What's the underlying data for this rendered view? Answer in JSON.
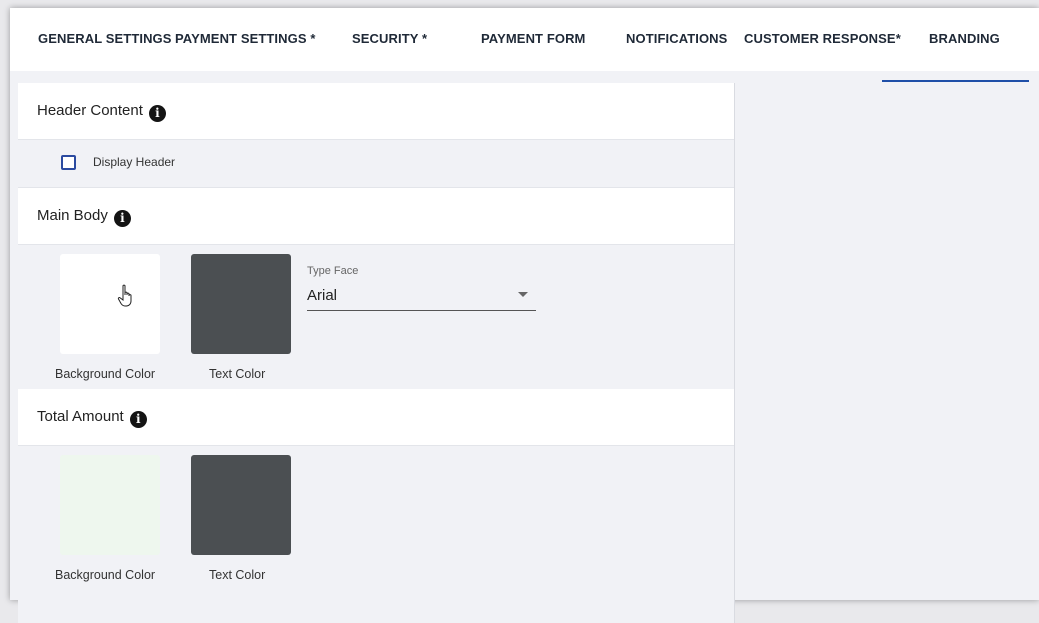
{
  "tabs": [
    {
      "label": "GENERAL SETTINGS"
    },
    {
      "label": "PAYMENT SETTINGS *"
    },
    {
      "label": "SECURITY *"
    },
    {
      "label": "PAYMENT FORM"
    },
    {
      "label": "NOTIFICATIONS"
    },
    {
      "label": "CUSTOMER RESPONSE*"
    },
    {
      "label": "BRANDING",
      "active": true
    }
  ],
  "sections": {
    "header_content": {
      "title": "Header Content",
      "display_header_label": "Display Header",
      "display_header_checked": false
    },
    "main_body": {
      "title": "Main Body",
      "background_label": "Background Color",
      "background_color": "#ffffff",
      "text_label": "Text Color",
      "text_color": "#4b4f52",
      "typeface_label": "Type Face",
      "typeface_value": "Arial"
    },
    "total_amount": {
      "title": "Total Amount",
      "background_label": "Background Color",
      "background_color": "#eef7ee",
      "text_label": "Text Color",
      "text_color": "#4b4f52"
    }
  },
  "icons": {
    "info": "info-icon",
    "cursor": "hand-pointer-icon",
    "dropdown": "caret-down-icon"
  },
  "colors": {
    "accent": "#1f4fa8",
    "panel_bg": "#f1f2f6"
  }
}
